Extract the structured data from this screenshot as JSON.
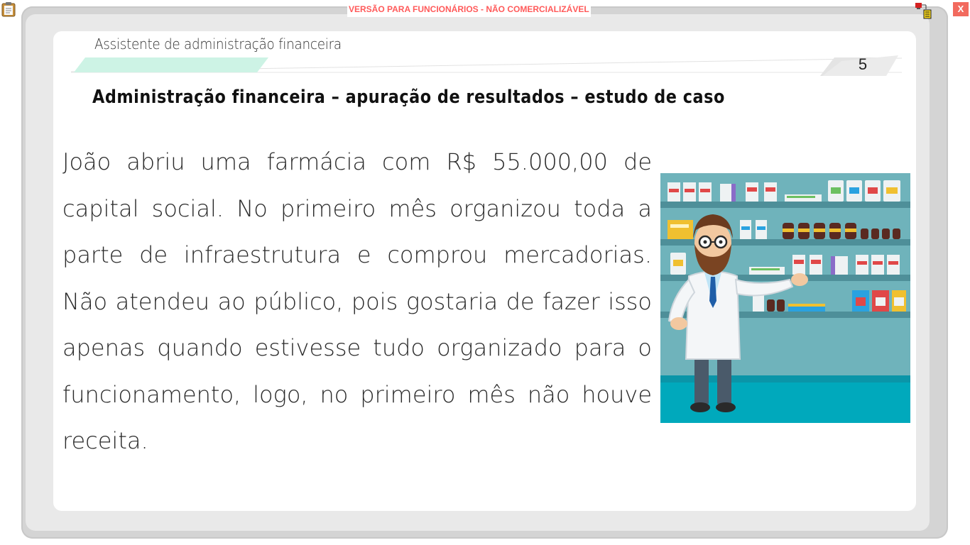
{
  "toolbar": {
    "clipboard_icon": "clipboard-icon",
    "watermark": "VERSÃO PARA FUNCIONÁRIOS - NÃO COMERCIALIZÁVEL",
    "status_icon": "network-status-icon",
    "close_label": "X"
  },
  "slide": {
    "subject": "Assistente de administração financeira",
    "page_number": "5",
    "title": "Administração financeira – apuração de resultados – estudo de caso",
    "body": "João abriu uma farmácia com R$ 55.000,00 de capital social. No primeiro mês organizou toda a parte de infraestrutura e comprou mercadorias. Não atendeu ao público, pois gostaria de fazer isso apenas quando estivesse tudo organizado para o funcionamento, logo, no primeiro mês não houve receita.",
    "illustration_icon": "pharmacist-illustration"
  },
  "colors": {
    "watermark": "#ff5a5a",
    "close": "#f26a5e",
    "accent_band": "#c9f2e3",
    "shelf_bg": "#6fb3bb",
    "floor": "#00a9bc"
  }
}
